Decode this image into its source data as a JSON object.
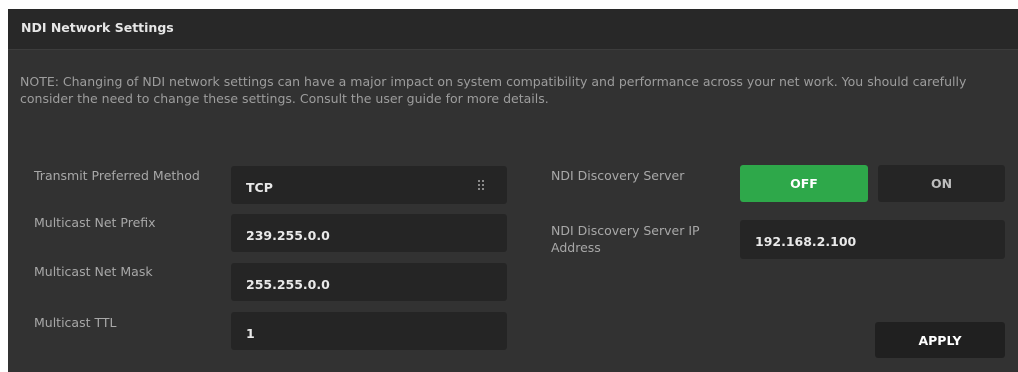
{
  "panel": {
    "title": "NDI Network Settings",
    "note": "NOTE: Changing of NDI network settings can have a major impact on system compatibility and performance across your net work. You should carefully consider the need to change these settings. Consult the user guide for more details."
  },
  "left_fields": {
    "transmit_method": {
      "label": "Transmit Preferred Method",
      "value": "TCP",
      "icon": "drag-grip-icon"
    },
    "multicast_prefix": {
      "label": "Multicast Net Prefix",
      "value": "239.255.0.0"
    },
    "multicast_mask": {
      "label": "Multicast Net Mask",
      "value": "255.255.0.0"
    },
    "multicast_ttl": {
      "label": "Multicast TTL",
      "value": "1"
    }
  },
  "right_fields": {
    "discovery_server": {
      "label": "NDI Discovery Server",
      "off_label": "OFF",
      "on_label": "ON",
      "selected": "OFF"
    },
    "discovery_ip": {
      "label": "NDI Discovery Server IP Address",
      "value": "192.168.2.100"
    }
  },
  "actions": {
    "apply_label": "APPLY"
  },
  "colors": {
    "panel_bg": "#323232",
    "header_bg": "#282828",
    "field_bg": "#252525",
    "accent_green": "#2ea84a"
  }
}
